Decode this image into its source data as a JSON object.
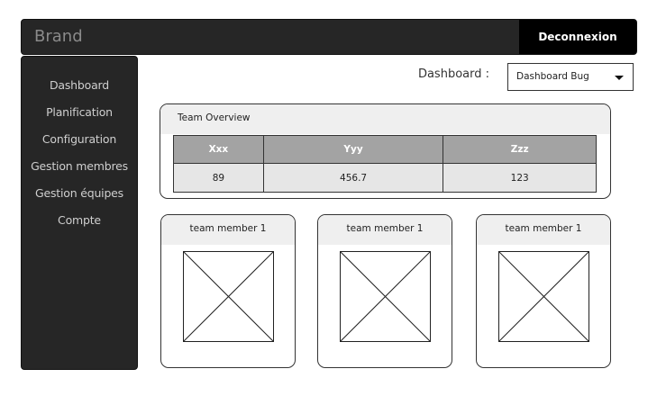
{
  "navbar": {
    "brand": "Brand",
    "logout_label": "Deconnexion"
  },
  "sidebar": {
    "items": [
      {
        "label": "Dashboard"
      },
      {
        "label": "Planification"
      },
      {
        "label": "Configuration"
      },
      {
        "label": "Gestion membres"
      },
      {
        "label": "Gestion équipes"
      },
      {
        "label": "Compte"
      }
    ]
  },
  "dashboard_selector": {
    "label": "Dashboard :",
    "selected": "Dashboard Bug"
  },
  "overview": {
    "title": "Team Overview",
    "columns": [
      "Xxx",
      "Yyy",
      "Zzz"
    ],
    "rows": [
      [
        "89",
        "456.7",
        "123"
      ]
    ]
  },
  "members": [
    {
      "name": "team member 1"
    },
    {
      "name": "team member 1"
    },
    {
      "name": "team member 1"
    }
  ],
  "colors": {
    "navbar_bg": "#262626",
    "logout_bg": "#000000",
    "table_header_bg": "#a3a3a3",
    "table_cell_bg": "#e6e6e6"
  }
}
